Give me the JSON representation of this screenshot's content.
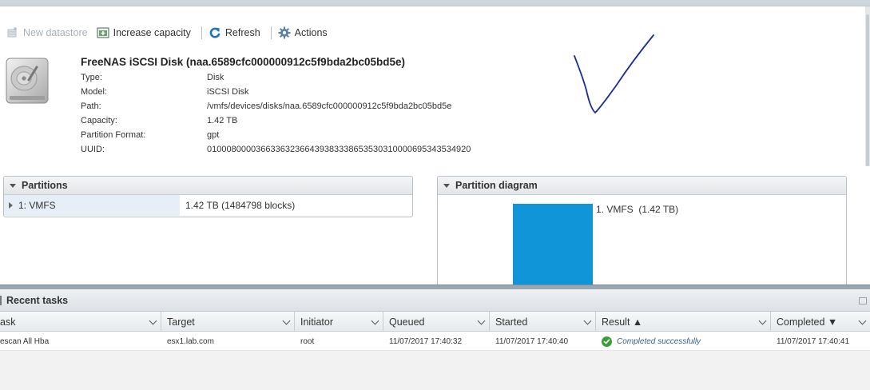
{
  "toolbar": {
    "new_datastore": "New datastore",
    "increase_capacity": "Increase capacity",
    "refresh": "Refresh",
    "actions": "Actions"
  },
  "disk": {
    "title": "FreeNAS iSCSI Disk (naa.6589cfc000000912c5f9bda2bc05bd5e)",
    "properties": [
      {
        "label": "Type:",
        "value": "Disk"
      },
      {
        "label": "Model:",
        "value": "iSCSI Disk"
      },
      {
        "label": "Path:",
        "value": "/vmfs/devices/disks/naa.6589cfc000000912c5f9bda2bc05bd5e"
      },
      {
        "label": "Capacity:",
        "value": "1.42 TB"
      },
      {
        "label": "Partition Format:",
        "value": "gpt"
      },
      {
        "label": "UUID:",
        "value": "01000800003663363236643938333865353031000069534353492​0"
      }
    ]
  },
  "partitions": {
    "title": "Partitions",
    "rows": [
      {
        "name": "1: VMFS",
        "size": "1.42 TB (1484798 blocks)"
      }
    ]
  },
  "diagram": {
    "title": "Partition diagram",
    "label": "1. VMFS  (1.42 TB)",
    "bar_color": "#0f95d8"
  },
  "recent_tasks": {
    "title": "Recent tasks",
    "columns": [
      "ask",
      "Target",
      "Initiator",
      "Queued",
      "Started",
      "Result ▲",
      "Completed ▼"
    ],
    "rows": [
      {
        "task": "escan All Hba",
        "target": "esx1.lab.com",
        "initiator": "root",
        "queued": "11/07/2017 17:40:32",
        "started": "11/07/2017 17:40:40",
        "result": "Completed successfully",
        "completed": "11/07/2017 17:40:41"
      }
    ]
  },
  "icons": {
    "new_datastore": "datastore-add-icon",
    "increase_capacity": "increase-capacity-icon",
    "refresh": "refresh-icon",
    "actions": "gear-icon",
    "disk": "hard-disk-icon",
    "result_ok": "check-circle-icon"
  },
  "colors": {
    "accent": "#0f95d8",
    "success": "#3a9d3a",
    "annotation_ink": "#1c2a9c"
  }
}
